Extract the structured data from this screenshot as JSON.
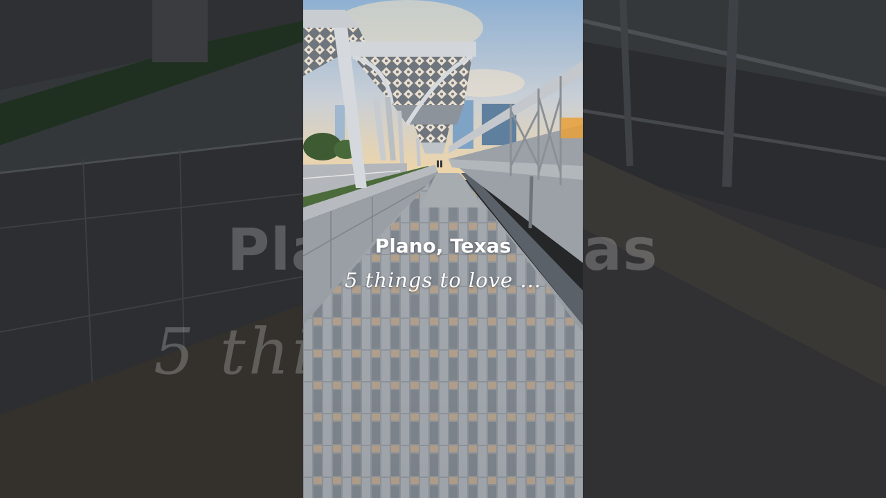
{
  "video": {
    "title": "Plano, Texas",
    "subtitle": "5 things to love ..."
  },
  "background": {
    "title_fragment_left": "Pla",
    "title_fragment_right": "as",
    "subtitle_echo": "5 thi          ove  ..."
  },
  "colors": {
    "sky_top": "#8fb0d2",
    "sky_glow": "#f2d6a4",
    "pavement": "#8d9298",
    "canopy": "#c7cbd0",
    "side_panels": "#2a2c2f"
  }
}
